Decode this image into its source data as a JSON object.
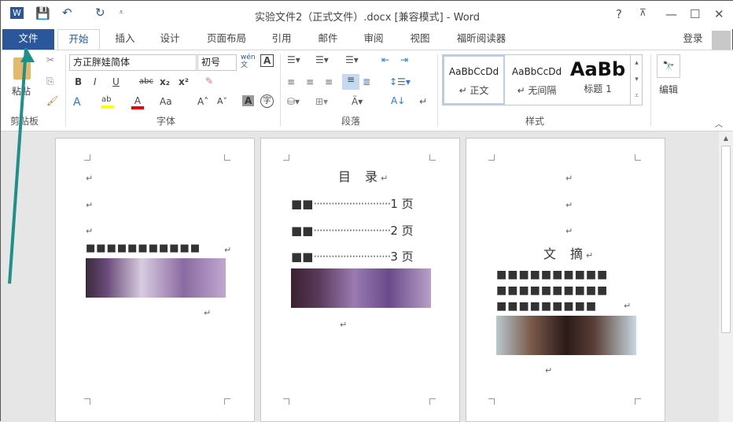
{
  "titlebar": {
    "title": "实验文件2（正式文件）.docx [兼容模式] - Word",
    "help": "?",
    "ribbon_display": "⊼",
    "minimize": "—",
    "maximize": "☐",
    "close": "✕",
    "save_icon": "💾",
    "undo": "↶",
    "redo": "↻",
    "customize": "⩡",
    "word_logo": "W"
  },
  "tabs": [
    "文件",
    "开始",
    "插入",
    "设计",
    "页面布局",
    "引用",
    "邮件",
    "审阅",
    "视图",
    "福昕阅读器"
  ],
  "login": "登录",
  "clipboard": {
    "paste": "粘贴",
    "group": "剪贴板"
  },
  "font": {
    "name": "方正胖娃简体",
    "size": "初号",
    "group": "字体",
    "bold": "B",
    "italic": "I",
    "underline": "U",
    "strike": "abc",
    "sub": "x₂",
    "sup": "x²",
    "case": "Aa",
    "grow": "A˄",
    "shrink": "A˅",
    "phonetic": "wén文",
    "border_char": "A",
    "shade_char": "A",
    "enclose": "字"
  },
  "paragraph": {
    "group": "段落"
  },
  "styles": {
    "group": "样式",
    "items": [
      {
        "preview": "AaBbCcDd",
        "name": "↵ 正文"
      },
      {
        "preview": "AaBbCcDd",
        "name": "↵ 无间隔"
      },
      {
        "preview": "AaBb",
        "name": "标题 1"
      }
    ]
  },
  "editing": {
    "label": "编辑"
  },
  "pages": {
    "p1": {
      "blocks": "■■■■■■■■■■■"
    },
    "p2": {
      "title": "目　录",
      "toc": [
        {
          "name": "■■",
          "page": "1 页"
        },
        {
          "name": "■■",
          "page": "2 页"
        },
        {
          "name": "■■",
          "page": "3 页"
        }
      ]
    },
    "p3": {
      "title": "文　摘",
      "lines": [
        "■■■■■■■■■■",
        "■■■■■■■■■■",
        "■■■■■■■■■"
      ]
    }
  },
  "ret": "↵"
}
